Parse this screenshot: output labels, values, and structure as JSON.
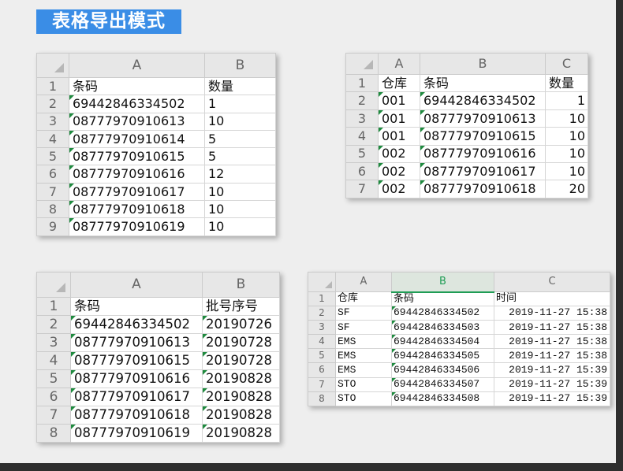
{
  "title": "表格导出模式",
  "colors": {
    "page_bg": "#eeeeee",
    "frame": "#2e2e2e",
    "title_bg": "#3a8de6",
    "title_text": "#ffffff",
    "number_as_text_indicator": "#1e8a3e",
    "selected_column": "#1f9d55"
  },
  "sheets": [
    {
      "columns": [
        {
          "label": "A",
          "text_numbers": true
        },
        {
          "label": "B",
          "text_numbers": false
        }
      ],
      "rows": [
        {
          "num": "1",
          "cells": [
            "条码",
            "数量"
          ]
        },
        {
          "num": "2",
          "cells": [
            "69442846334502",
            "1"
          ]
        },
        {
          "num": "3",
          "cells": [
            "08777970910613",
            "10"
          ]
        },
        {
          "num": "4",
          "cells": [
            "08777970910614",
            "5"
          ]
        },
        {
          "num": "5",
          "cells": [
            "08777970910615",
            "5"
          ]
        },
        {
          "num": "6",
          "cells": [
            "08777970910616",
            "12"
          ]
        },
        {
          "num": "7",
          "cells": [
            "08777970910617",
            "10"
          ]
        },
        {
          "num": "8",
          "cells": [
            "08777970910618",
            "10"
          ]
        },
        {
          "num": "9",
          "cells": [
            "08777970910619",
            "10"
          ]
        }
      ]
    },
    {
      "columns": [
        {
          "label": "A",
          "text_numbers": true
        },
        {
          "label": "B",
          "text_numbers": true
        },
        {
          "label": "C",
          "text_numbers": false
        }
      ],
      "rows": [
        {
          "num": "1",
          "cells": [
            "仓库",
            "条码",
            "数量"
          ]
        },
        {
          "num": "2",
          "cells": [
            "001",
            "69442846334502",
            "1"
          ]
        },
        {
          "num": "3",
          "cells": [
            "001",
            "08777970910613",
            "10"
          ]
        },
        {
          "num": "4",
          "cells": [
            "001",
            "08777970910615",
            "10"
          ]
        },
        {
          "num": "5",
          "cells": [
            "002",
            "08777970910616",
            "10"
          ]
        },
        {
          "num": "6",
          "cells": [
            "002",
            "08777970910617",
            "10"
          ]
        },
        {
          "num": "7",
          "cells": [
            "002",
            "08777970910618",
            "20"
          ]
        }
      ]
    },
    {
      "columns": [
        {
          "label": "A",
          "text_numbers": true
        },
        {
          "label": "B",
          "text_numbers": true
        }
      ],
      "rows": [
        {
          "num": "1",
          "cells": [
            "条码",
            "批号序号"
          ]
        },
        {
          "num": "2",
          "cells": [
            "69442846334502",
            "20190726"
          ]
        },
        {
          "num": "3",
          "cells": [
            "08777970910613",
            "20190728"
          ]
        },
        {
          "num": "4",
          "cells": [
            "08777970910615",
            "20190728"
          ]
        },
        {
          "num": "5",
          "cells": [
            "08777970910616",
            "20190828"
          ]
        },
        {
          "num": "6",
          "cells": [
            "08777970910617",
            "20190828"
          ]
        },
        {
          "num": "7",
          "cells": [
            "08777970910618",
            "20190828"
          ]
        },
        {
          "num": "8",
          "cells": [
            "08777970910619",
            "20190828"
          ]
        }
      ]
    },
    {
      "columns": [
        {
          "label": "A",
          "text_numbers": false
        },
        {
          "label": "B",
          "text_numbers": true,
          "selected": true
        },
        {
          "label": "C",
          "text_numbers": false
        }
      ],
      "rows": [
        {
          "num": "1",
          "cells": [
            "仓库",
            "条码",
            "时间"
          ]
        },
        {
          "num": "2",
          "cells": [
            "SF",
            "69442846334502",
            "2019-11-27 15:38"
          ]
        },
        {
          "num": "3",
          "cells": [
            "SF",
            "69442846334503",
            "2019-11-27 15:38"
          ]
        },
        {
          "num": "4",
          "cells": [
            "EMS",
            "69442846334504",
            "2019-11-27 15:38"
          ]
        },
        {
          "num": "5",
          "cells": [
            "EMS",
            "69442846334505",
            "2019-11-27 15:38"
          ]
        },
        {
          "num": "6",
          "cells": [
            "EMS",
            "69442846334506",
            "2019-11-27 15:39"
          ]
        },
        {
          "num": "7",
          "cells": [
            "STO",
            "69442846334507",
            "2019-11-27 15:39"
          ]
        },
        {
          "num": "8",
          "cells": [
            "STO",
            "69442846334508",
            "2019-11-27 15:39"
          ]
        }
      ]
    }
  ]
}
